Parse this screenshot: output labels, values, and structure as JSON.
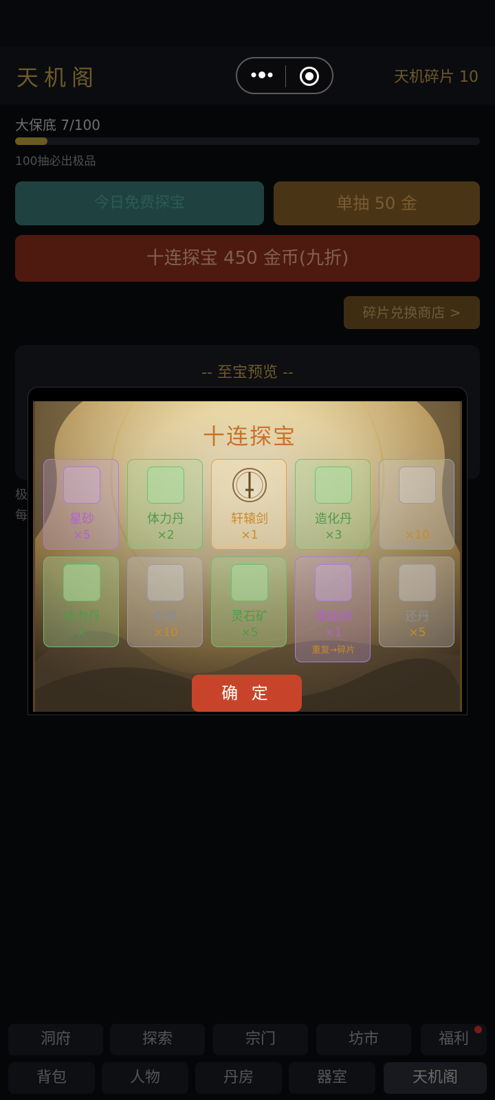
{
  "header": {
    "title": "天机阁",
    "shards": "天机碎片 10"
  },
  "pity": {
    "label": "大保底 7/100",
    "progress": 0.07,
    "sub": "100抽必出极品"
  },
  "buttons": {
    "free": "今日免费探宝",
    "single": "单抽 50 金",
    "ten": "十连探宝  450 金币(九折)",
    "shop": "碎片兑换商店 >"
  },
  "preview": {
    "title": "-- 至宝预览 --",
    "side_1": "极",
    "side_2": "每"
  },
  "modal": {
    "title": "十连探宝",
    "confirm": "确 定",
    "cards": [
      {
        "name": "星砂",
        "qty": "×5",
        "tier": "purple"
      },
      {
        "name": "体力丹",
        "qty": "×2",
        "tier": "green"
      },
      {
        "name": "轩辕剑",
        "qty": "×1",
        "tier": "orange"
      },
      {
        "name": "造化丹",
        "qty": "×3",
        "tier": "green"
      },
      {
        "name": "",
        "qty": "×10",
        "tier": "gray"
      },
      {
        "name": "体力丹",
        "qty": "×",
        "tier": "green"
      },
      {
        "name": "玄铁",
        "qty": "×10",
        "tier": "gray"
      },
      {
        "name": "灵石矿",
        "qty": "×5",
        "tier": "green"
      },
      {
        "name": "诛仙剑",
        "qty": "×1",
        "tier": "purple",
        "note": "重复→碎片"
      },
      {
        "name": "还丹",
        "qty": "×5",
        "tier": "gray"
      }
    ]
  },
  "tabs_row1": [
    "洞府",
    "探索",
    "宗门",
    "坊市",
    "福利"
  ],
  "tabs_row2": [
    "背包",
    "人物",
    "丹房",
    "器室",
    "天机阁"
  ],
  "colors": {
    "accent_gold": "#c98a2a",
    "confirm_red": "#c7442a"
  }
}
